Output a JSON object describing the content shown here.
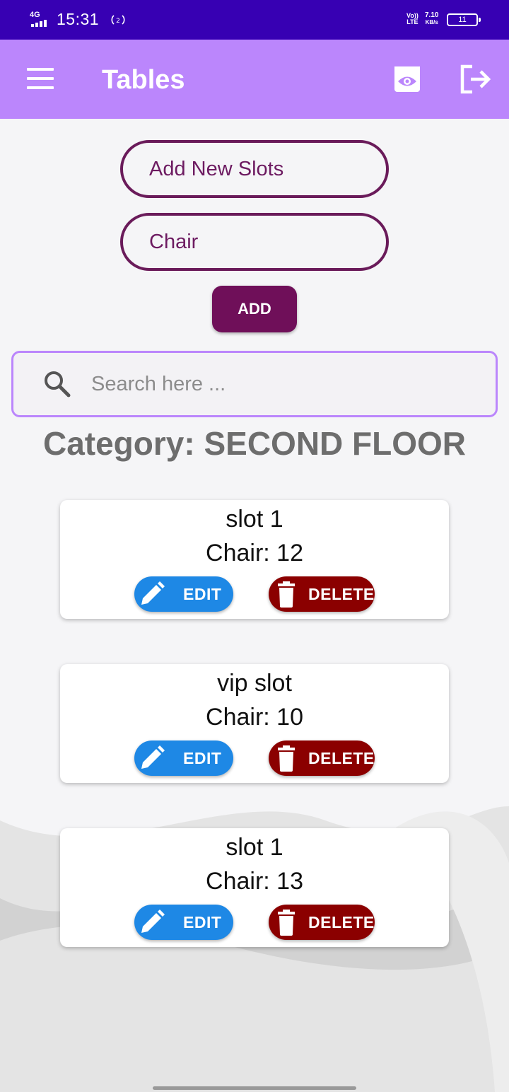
{
  "status_bar": {
    "network": "4G",
    "time": "15:31",
    "hotspot": "2",
    "volte_top": "Vo))",
    "volte_bottom": "LTE",
    "speed_value": "7.10",
    "speed_unit": "KB/s",
    "battery": "11"
  },
  "app_bar": {
    "title": "Tables",
    "icons": [
      "menu-icon",
      "eye-icon",
      "logout-icon"
    ]
  },
  "form": {
    "slot_name_value": "Add New Slots",
    "chair_value": "Chair",
    "add_label": "ADD"
  },
  "search": {
    "placeholder": "Search here ..."
  },
  "category": {
    "heading": "Category: SECOND FLOOR"
  },
  "slots": [
    {
      "name": "slot 1",
      "chairs": "Chair: 12",
      "edit_label": "EDIT",
      "delete_label": "DELETE"
    },
    {
      "name": "vip slot",
      "chairs": "Chair: 10",
      "edit_label": "EDIT",
      "delete_label": "DELETE"
    },
    {
      "name": "slot 1",
      "chairs": "Chair: 13",
      "edit_label": "EDIT",
      "delete_label": "DELETE"
    }
  ],
  "colors": {
    "status_bar": "#3700b3",
    "app_bar": "#bb86fc",
    "form_accent": "#6f0f59",
    "edit": "#1e88e5",
    "delete": "#8b0000"
  }
}
